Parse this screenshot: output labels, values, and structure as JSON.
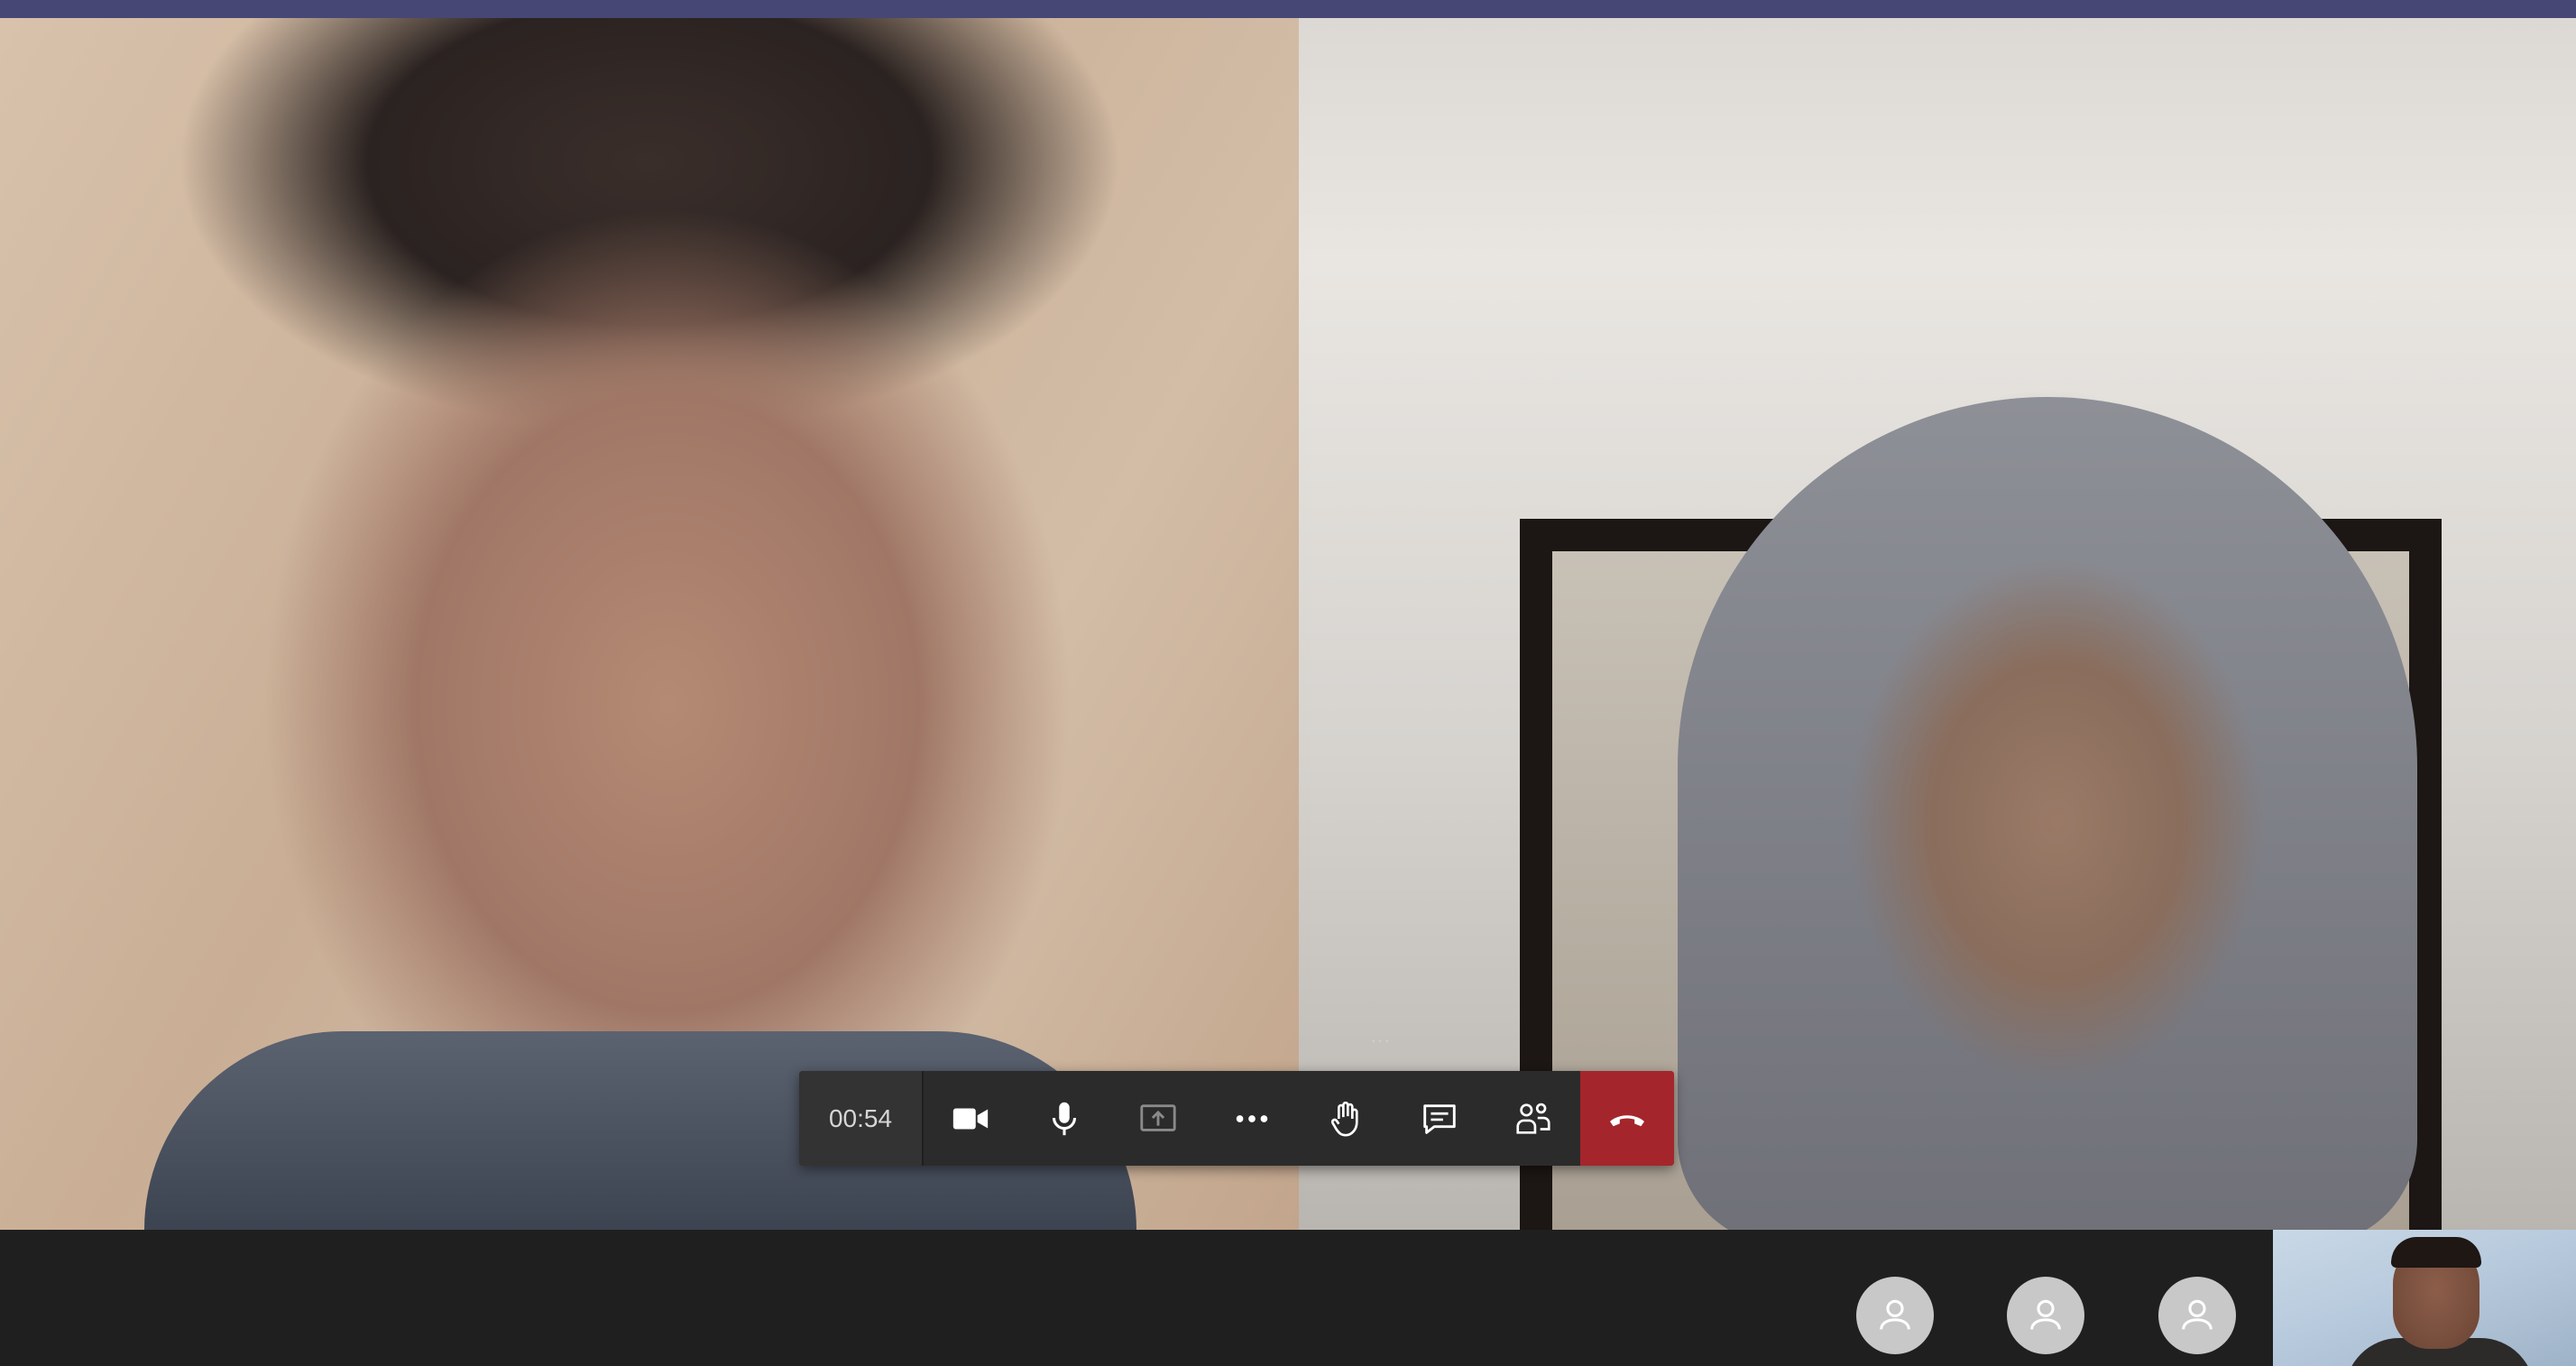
{
  "call": {
    "timer": "00:54",
    "overflow_dots": "...",
    "controls": [
      {
        "name": "camera",
        "icon": "video-camera-icon"
      },
      {
        "name": "microphone",
        "icon": "microphone-icon"
      },
      {
        "name": "share",
        "icon": "share-screen-icon"
      },
      {
        "name": "more",
        "icon": "more-actions-icon"
      },
      {
        "name": "raise-hand",
        "icon": "raise-hand-icon"
      },
      {
        "name": "chat",
        "icon": "chat-icon"
      },
      {
        "name": "participants",
        "icon": "participants-icon"
      },
      {
        "name": "hang-up",
        "icon": "hang-up-icon"
      }
    ],
    "colors": {
      "top_bar": "#464775",
      "hang_up": "#a4262c",
      "control_bar": "#2b2b2b",
      "background": "#1f1f1f"
    }
  },
  "participants_tray": {
    "avatars": [
      "person-avatar-icon",
      "person-avatar-icon",
      "person-avatar-icon"
    ],
    "self_view": "self-video"
  }
}
